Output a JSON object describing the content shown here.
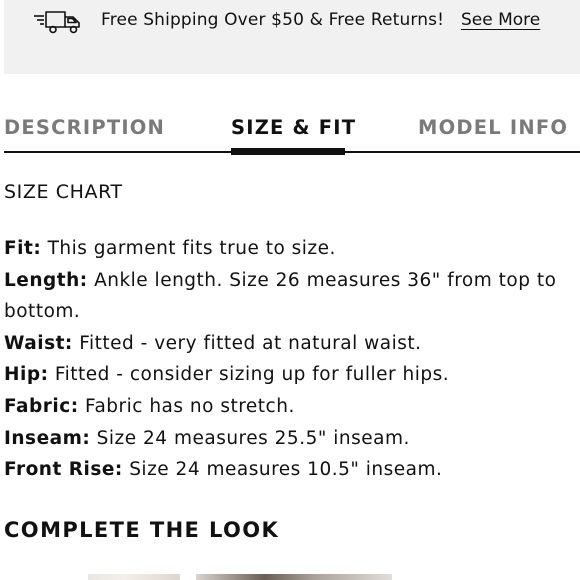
{
  "banner": {
    "icon": "delivery-truck-icon",
    "text": "Free Shipping Over $50 & Free Returns!",
    "link": "See More"
  },
  "tabs": [
    {
      "label": "DESCRIPTION",
      "active": false
    },
    {
      "label": "SIZE & FIT",
      "active": true
    },
    {
      "label": "MODEL INFO",
      "active": false
    }
  ],
  "size_chart_label": "SIZE CHART",
  "specs": [
    {
      "label": "Fit:",
      "value": "This garment fits true to size."
    },
    {
      "label": "Length:",
      "value": "Ankle length. Size 26 measures 36\" from top to bottom."
    },
    {
      "label": "Waist:",
      "value": "Fitted - very fitted at natural waist."
    },
    {
      "label": "Hip:",
      "value": "Fitted - consider sizing up for fuller hips."
    },
    {
      "label": "Fabric:",
      "value": "Fabric has no stretch."
    },
    {
      "label": "Inseam:",
      "value": "Size 24 measures 25.5\" inseam."
    },
    {
      "label": "Front Rise:",
      "value": "Size 24 measures 10.5\" inseam."
    }
  ],
  "complete_the_look": "COMPLETE THE LOOK",
  "colors": {
    "banner_bg": "#f1f1f1",
    "text": "#111111",
    "inactive_tab": "#7a7a7a"
  }
}
